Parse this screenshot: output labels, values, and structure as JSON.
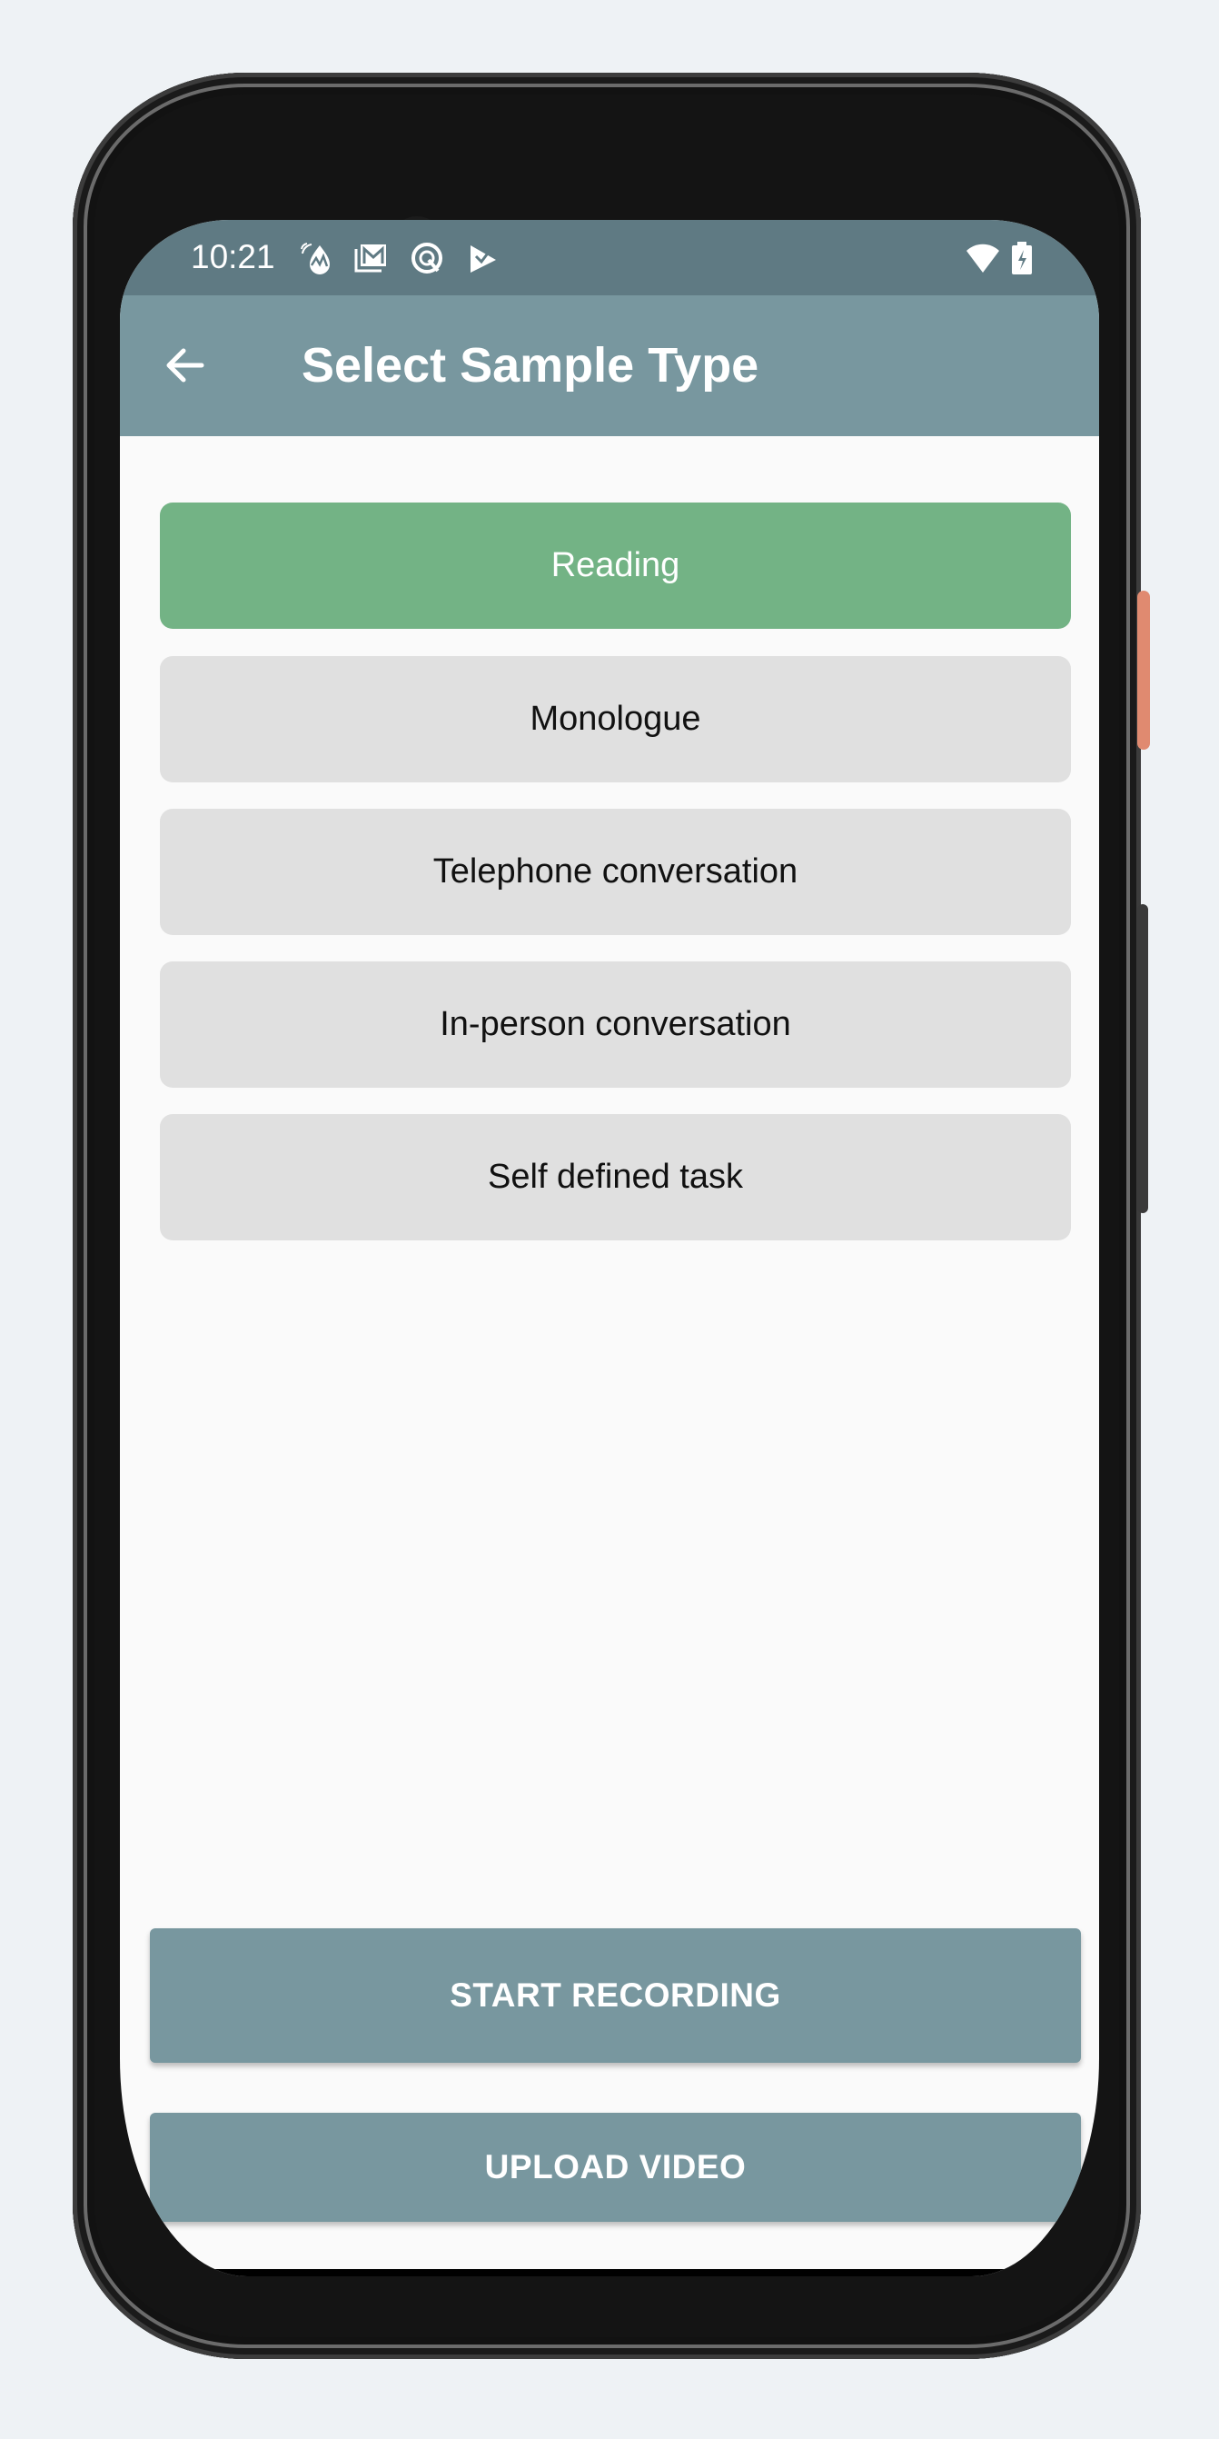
{
  "status_bar": {
    "time": "10:21",
    "left_icons": [
      "water-drop-chart-icon",
      "gmail-stack-icon",
      "quick-search-icon",
      "play-check-icon"
    ],
    "right_icons": [
      "wifi-icon",
      "battery-charging-icon"
    ]
  },
  "app_bar": {
    "back_icon": "arrow-back-icon",
    "title": "Select Sample Type"
  },
  "sample_types": [
    {
      "label": "Reading",
      "selected": true
    },
    {
      "label": "Monologue",
      "selected": false
    },
    {
      "label": "Telephone conversation",
      "selected": false
    },
    {
      "label": "In-person conversation",
      "selected": false
    },
    {
      "label": "Self defined task",
      "selected": false
    }
  ],
  "actions": {
    "start_recording": "START RECORDING",
    "upload_video": "UPLOAD VIDEO"
  },
  "colors": {
    "status_bar": "#5f7a83",
    "app_bar": "#78979f",
    "selected_option": "#73b385",
    "unselected_option": "#e0e0e0",
    "action_button": "#78979f"
  }
}
